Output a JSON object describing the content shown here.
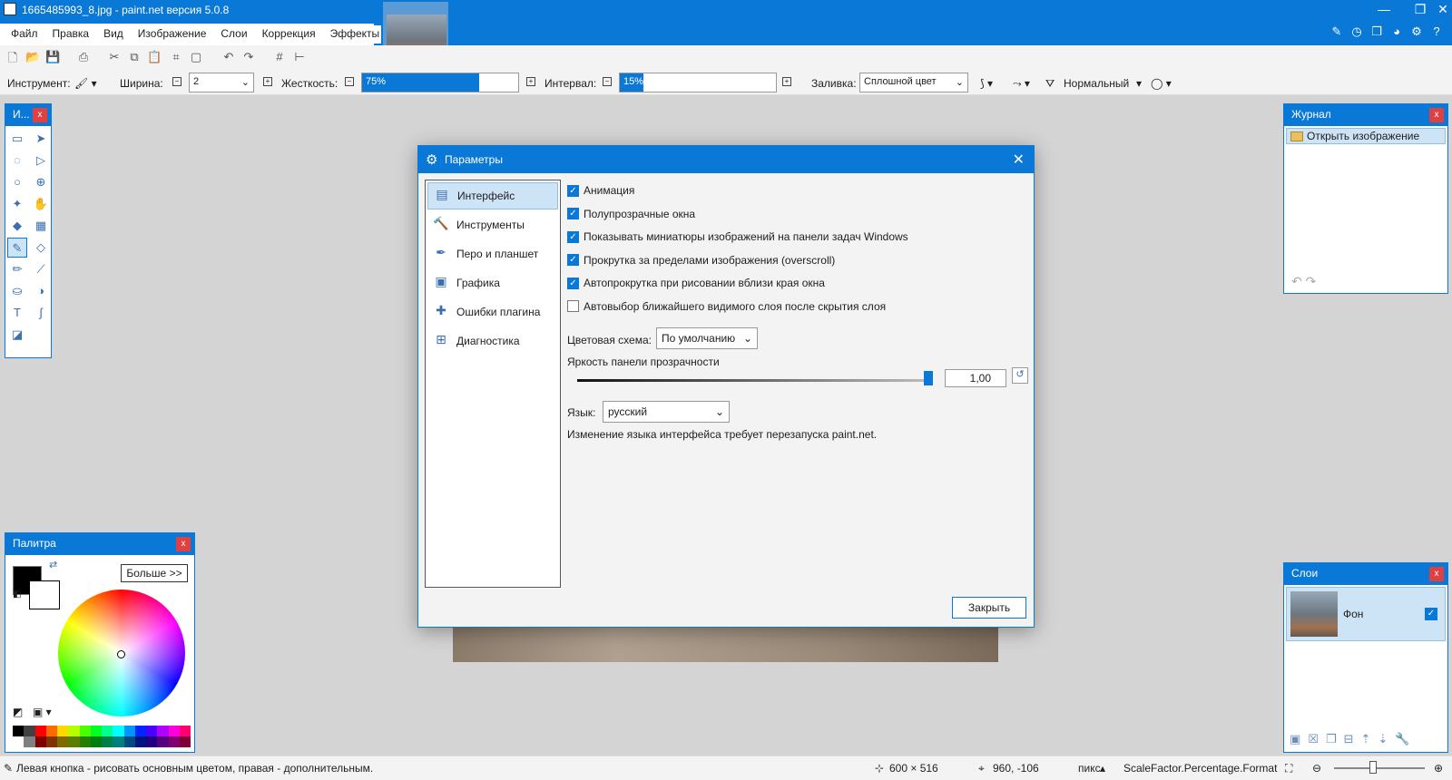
{
  "window": {
    "title": "1665485993_8.jpg - paint.net версия 5.0.8",
    "controls": [
      "—",
      "❐",
      "✕"
    ]
  },
  "menu": [
    "Файл",
    "Правка",
    "Вид",
    "Изображение",
    "Слои",
    "Коррекция",
    "Эффекты"
  ],
  "toolbar2": {
    "tool_label": "Инструмент:",
    "width_label": "Ширина:",
    "width_value": "2",
    "hardness_label": "Жесткость:",
    "hardness_value": "75%",
    "hardness_level": 0.75,
    "interval_label": "Интервал:",
    "interval_value": "15%",
    "interval_level": 0.15,
    "fill_label": "Заливка:",
    "fill_value": "Сплошной цвет",
    "blend_value": "Нормальный"
  },
  "tools_panel": {
    "title": "И...",
    "close": "x",
    "tools": [
      {
        "icon": "rect-select-icon",
        "glyph": "▭"
      },
      {
        "icon": "move-selection-icon",
        "glyph": "➤"
      },
      {
        "icon": "lasso-icon",
        "glyph": "◌"
      },
      {
        "icon": "move-selected-icon",
        "glyph": "▷"
      },
      {
        "icon": "ellipse-select-icon",
        "glyph": "○"
      },
      {
        "icon": "zoom-icon",
        "glyph": "⊕"
      },
      {
        "icon": "magic-wand-icon",
        "glyph": "✦"
      },
      {
        "icon": "pan-icon",
        "glyph": "✋"
      },
      {
        "icon": "paint-bucket-icon",
        "glyph": "◆"
      },
      {
        "icon": "gradient-icon",
        "glyph": "▦"
      },
      {
        "icon": "paintbrush-icon",
        "glyph": "✎",
        "selected": true
      },
      {
        "icon": "eraser-icon",
        "glyph": "◇"
      },
      {
        "icon": "pencil-icon",
        "glyph": "✏"
      },
      {
        "icon": "color-picker-icon",
        "glyph": "⟋"
      },
      {
        "icon": "clone-stamp-icon",
        "glyph": "⛀"
      },
      {
        "icon": "recolor-icon",
        "glyph": "◑"
      },
      {
        "icon": "text-icon",
        "glyph": "T"
      },
      {
        "icon": "line-curve-icon",
        "glyph": "∫"
      },
      {
        "icon": "shapes-icon",
        "glyph": "◪"
      }
    ]
  },
  "palette": {
    "title": "Палитра",
    "close": "x",
    "more_label": "Больше >>",
    "primary": "#000000",
    "secondary": "#ffffff",
    "swatches": [
      "#000000",
      "#404040",
      "#ff0000",
      "#ff6a00",
      "#ffd800",
      "#b6ff00",
      "#4cff00",
      "#00ff21",
      "#00ff90",
      "#00ffff",
      "#0094ff",
      "#0026ff",
      "#4800ff",
      "#b200ff",
      "#ff00dc",
      "#ff006e",
      "#ffffff",
      "#808080",
      "#7f0000",
      "#7f3300",
      "#7f6a00",
      "#5b7f00",
      "#267f00",
      "#007f0e",
      "#007f46",
      "#007f7f",
      "#004a7f",
      "#00137f",
      "#21007f",
      "#57007f",
      "#7f006e",
      "#7f0037"
    ]
  },
  "history": {
    "title": "Журнал",
    "close": "x",
    "item": "Открыть изображение"
  },
  "layers": {
    "title": "Слои",
    "close": "x",
    "layer_name": "Фон"
  },
  "dialog": {
    "title": "Параметры",
    "nav": [
      {
        "label": "Интерфейс",
        "icon": "interface-icon",
        "glyph": "▤",
        "selected": true
      },
      {
        "label": "Инструменты",
        "icon": "tools-icon",
        "glyph": "🔨"
      },
      {
        "label": "Перо и планшет",
        "icon": "pen-tablet-icon",
        "glyph": "✒"
      },
      {
        "label": "Графика",
        "icon": "graphics-icon",
        "glyph": "▣"
      },
      {
        "label": "Ошибки плагина",
        "icon": "plugin-errors-icon",
        "glyph": "✚"
      },
      {
        "label": "Диагностика",
        "icon": "diagnostics-icon",
        "glyph": "⊞"
      }
    ],
    "options": [
      {
        "label": "Анимация",
        "checked": true
      },
      {
        "label": "Полупрозрачные окна",
        "checked": true
      },
      {
        "label": "Показывать миниатюры изображений на панели задач Windows",
        "checked": true
      },
      {
        "label": "Прокрутка за пределами изображения (overscroll)",
        "checked": true
      },
      {
        "label": "Автопрокрутка при рисовании вблизи края окна",
        "checked": true
      },
      {
        "label": "Автовыбор ближайшего видимого слоя после скрытия слоя",
        "checked": false
      }
    ],
    "color_scheme_label": "Цветовая схема:",
    "color_scheme_value": "По умолчанию",
    "brightness_label": "Яркость панели прозрачности",
    "brightness_value": "1,00",
    "language_label": "Язык:",
    "language_value": "русский",
    "language_note": "Изменение языка интерфейса требует перезапуска paint.net.",
    "close_label": "Закрыть"
  },
  "status": {
    "hint": "Левая кнопка - рисовать основным цветом, правая - дополнительным.",
    "size": "600 × 516",
    "coords": "960, -106",
    "units": "пикс",
    "zoom_text": "ScaleFactor.Percentage.Format"
  },
  "colors": {
    "accent": "#0a78d7",
    "selection": "#cde4f7",
    "workspace": "#d4d4d4"
  }
}
